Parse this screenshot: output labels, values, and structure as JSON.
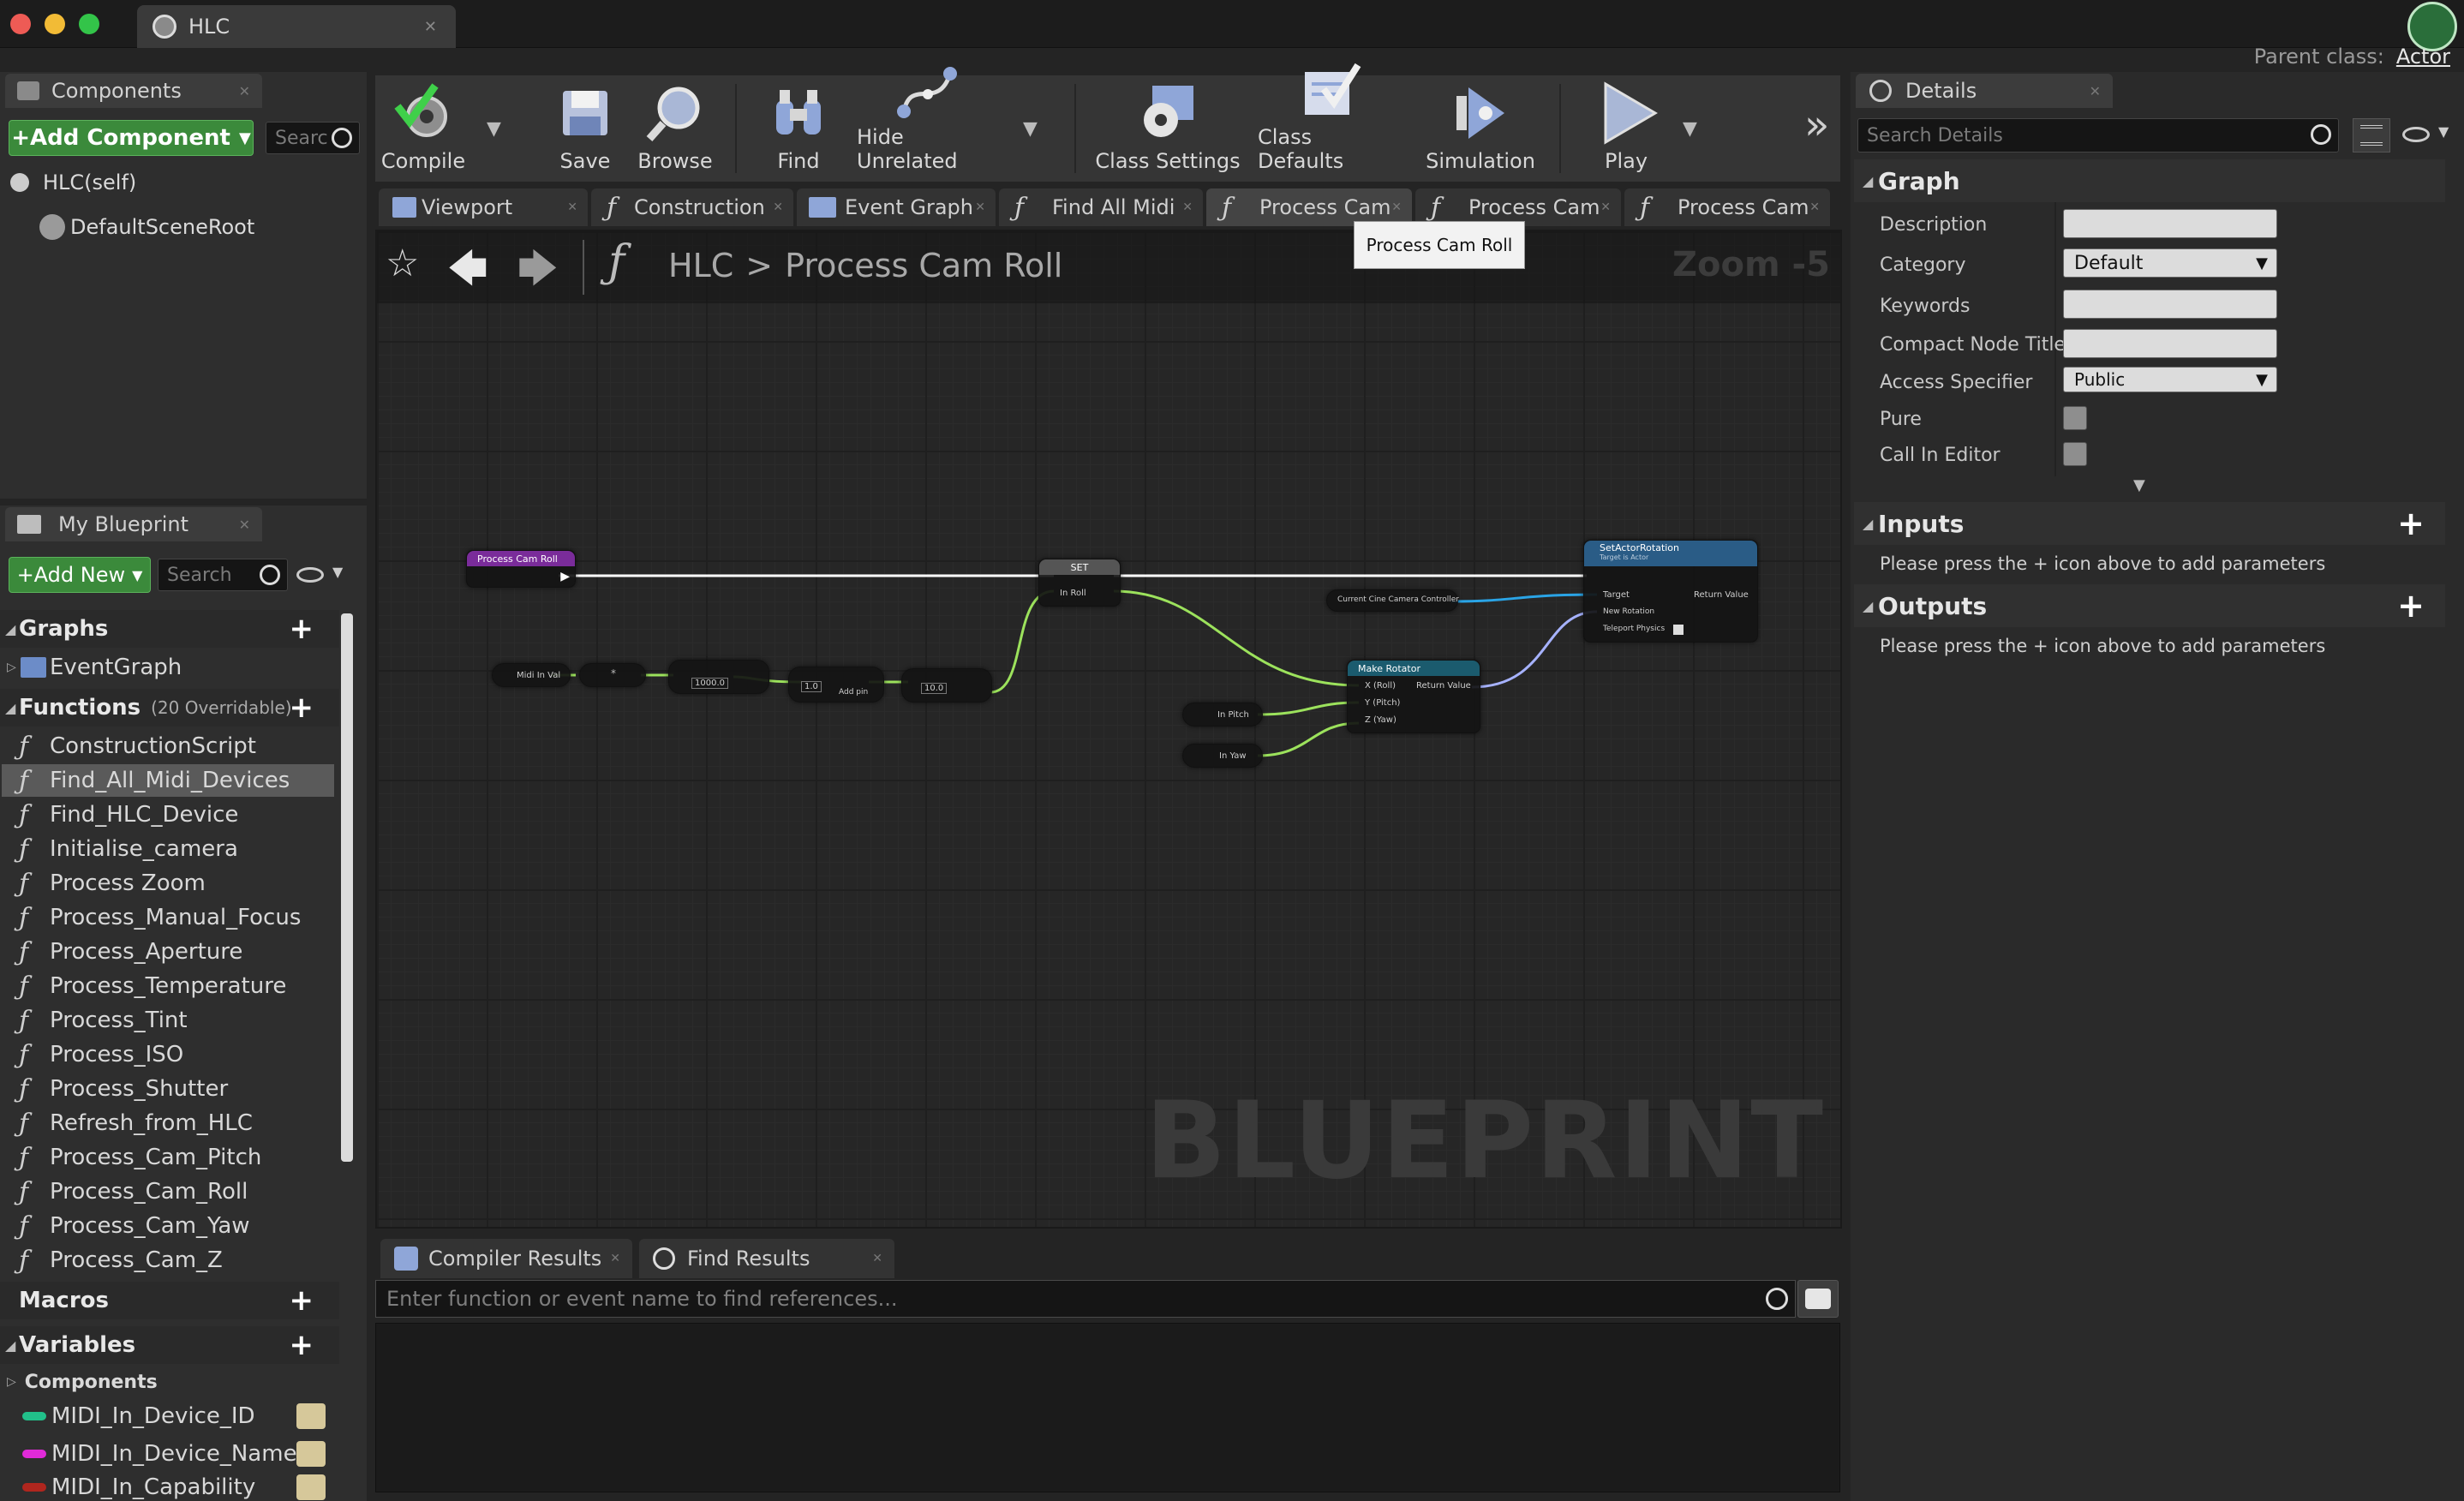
{
  "window": {
    "tab_title": "HLC"
  },
  "parent_class": {
    "label": "Parent class:",
    "value": "Actor"
  },
  "components_panel": {
    "tab_label": "Components",
    "add_button": "+Add Component",
    "search_placeholder": "Searc",
    "items": [
      "HLC(self)",
      "DefaultSceneRoot"
    ]
  },
  "toolbar": {
    "compile": "Compile",
    "save": "Save",
    "browse": "Browse",
    "find": "Find",
    "hide_unrelated": "Hide Unrelated",
    "class_settings": "Class Settings",
    "class_defaults": "Class Defaults",
    "simulation": "Simulation",
    "play": "Play"
  },
  "doc_tabs": [
    "Viewport",
    "Construction",
    "Event Graph",
    "Find All Midi",
    "Process Cam",
    "Process Cam",
    "Process Cam"
  ],
  "tooltip": "Process Cam Roll",
  "graph": {
    "breadcrumb_root": "HLC",
    "breadcrumb_sep": ">",
    "breadcrumb_current": "Process Cam Roll",
    "zoom": "Zoom -5",
    "watermark": "BLUEPRINT",
    "nodes": {
      "entry": "Process Cam Roll",
      "set": "SET",
      "in_roll": "In Roll",
      "midi_in_val": "Midi In Val",
      "val_1000": "1000.0",
      "val_1": "1.0",
      "add_pin": "Add pin",
      "val_10": "10.0",
      "current_cine": "Current Cine Camera Controller",
      "make_rotator": "Make Rotator",
      "x_roll": "X (Roll)",
      "y_pitch": "Y (Pitch)",
      "z_yaw": "Z (Yaw)",
      "return_value": "Return Value",
      "in_pitch": "In Pitch",
      "in_yaw": "In Yaw",
      "set_actor_rotation": "SetActorRotation",
      "target_is_actor": "Target is Actor",
      "target": "Target",
      "new_rotation": "New Rotation",
      "teleport_physics": "Teleport Physics"
    }
  },
  "my_blueprint": {
    "tab_label": "My Blueprint",
    "add_new": "+Add New",
    "search_placeholder": "Search",
    "graphs_header": "Graphs",
    "event_graph": "EventGraph",
    "functions_header": "Functions",
    "functions_overridable": "(20 Overridable)",
    "functions": [
      "ConstructionScript",
      "Find_All_Midi_Devices",
      "Find_HLC_Device",
      "Initialise_camera",
      "Process Zoom",
      "Process_Manual_Focus",
      "Process_Aperture",
      "Process_Temperature",
      "Process_Tint",
      "Process_ISO",
      "Process_Shutter",
      "Refresh_from_HLC",
      "Process_Cam_Pitch",
      "Process_Cam_Roll",
      "Process_Cam_Yaw",
      "Process_Cam_Z"
    ],
    "macros_header": "Macros",
    "variables_header": "Variables",
    "variables_subheader": "Components",
    "variables": [
      {
        "name": "MIDI_In_Device_ID",
        "color": "#21c08a"
      },
      {
        "name": "MIDI_In_Device_Name",
        "color": "#e02ad8"
      },
      {
        "name": "MIDI_In_Capability",
        "color": "#b0261e"
      }
    ]
  },
  "bottom": {
    "compiler_results": "Compiler Results",
    "find_results": "Find Results",
    "find_placeholder": "Enter function or event name to find references..."
  },
  "details": {
    "tab_label": "Details",
    "search_placeholder": "Search Details",
    "graph_header": "Graph",
    "description_label": "Description",
    "category_label": "Category",
    "category_value": "Default",
    "keywords_label": "Keywords",
    "compact_label": "Compact Node Title",
    "access_label": "Access Specifier",
    "access_value": "Public",
    "pure_label": "Pure",
    "call_in_editor_label": "Call In Editor",
    "inputs_header": "Inputs",
    "inputs_note": "Please press the + icon above to add parameters",
    "outputs_header": "Outputs",
    "outputs_note": "Please press the + icon above to add parameters"
  }
}
